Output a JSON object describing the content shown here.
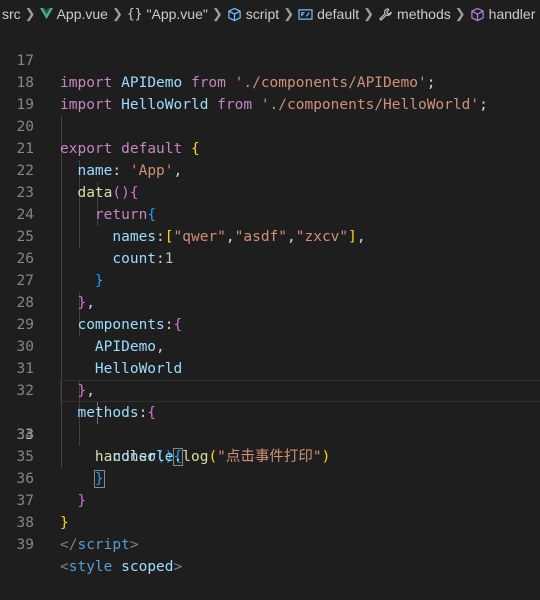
{
  "breadcrumbs": {
    "src": "src",
    "file": "App.vue",
    "object": "\"App.vue\"",
    "script": "script",
    "default": "default",
    "methods": "methods",
    "handler": "handler",
    "icons": [
      "vue-icon",
      "braces-icon",
      "cube-icon",
      "field-icon",
      "wrench-icon",
      "method-icon"
    ]
  },
  "editor": {
    "current_line": 33,
    "line_numbers": [
      "17",
      "18",
      "19",
      "20",
      "21",
      "22",
      "23",
      "24",
      "25",
      "26",
      "27",
      "28",
      "29",
      "30",
      "31",
      "32",
      "33",
      "34",
      "35",
      "36",
      "37",
      "38",
      "39"
    ],
    "code": {
      "l17": {
        "kw": "import",
        "id": "APIDemo",
        "from": "from",
        "str": "'./components/APIDemo'",
        "semi": ";"
      },
      "l18": {
        "kw": "import",
        "id": "HelloWorld",
        "from": "from",
        "str": "'./components/HelloWorld'",
        "semi": ";"
      },
      "l20": {
        "kw1": "export",
        "kw2": "default",
        "brace": "{"
      },
      "l21": {
        "key": "name",
        "colon": ": ",
        "str": "'App'",
        "comma": ","
      },
      "l22": {
        "fn": "data",
        "paren": "()",
        "brace": "{"
      },
      "l23": {
        "kw": "return",
        "brace": "{"
      },
      "l24": {
        "key": "names",
        "colon": ":",
        "open": "[",
        "s1": "\"qwer\"",
        "c1": ",",
        "s2": "\"asdf\"",
        "c2": ",",
        "s3": "\"zxcv\"",
        "close": "]",
        "comma": ","
      },
      "l25": {
        "key": "count",
        "colon": ":",
        "num": "1"
      },
      "l26": {
        "brace": "}"
      },
      "l27": {
        "brace": "}",
        "comma": ","
      },
      "l28": {
        "key": "components",
        "colon": ":",
        "brace": "{"
      },
      "l29": {
        "id": "APIDemo",
        "comma": ","
      },
      "l30": {
        "id": "HelloWorld"
      },
      "l31": {
        "brace": "}",
        "comma": ","
      },
      "l32": {
        "key": "methods",
        "colon": ":",
        "brace": "{"
      },
      "l33": {
        "fn": "handler",
        "paren": "()",
        "brace": "{"
      },
      "l34": {
        "obj": "console",
        "dot": ".",
        "fn": "log",
        "open": "(",
        "str": "\"点击事件打印\"",
        "close": ")"
      },
      "l35": {
        "brace": "}"
      },
      "l36": {
        "brace": "}"
      },
      "l37": {
        "brace": "}"
      },
      "l38": {
        "open": "</",
        "tag": "script",
        "close": ">"
      },
      "l39": {
        "open": "<",
        "tag": "style",
        "attr": "scoped",
        "close": ">"
      }
    }
  },
  "colors": {
    "background": "#1e1e1e",
    "keyword": "#c586c0",
    "storage": "#569cd6",
    "variable": "#9cdcfe",
    "function": "#dcdcaa",
    "string": "#ce9178",
    "number": "#b5cea8",
    "bracket_level1": "#ffd700",
    "bracket_level2": "#da70d6",
    "bracket_level3": "#179fff"
  }
}
